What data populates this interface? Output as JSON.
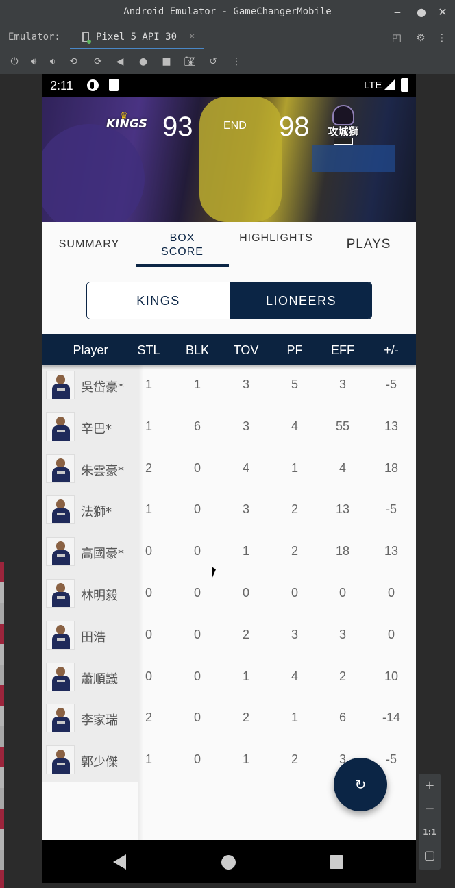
{
  "window": {
    "title": "Android Emulator - GameChangerMobile",
    "minimize_icon": "minimize-icon",
    "close_icon": "close-icon"
  },
  "emulator_bar": {
    "label": "Emulator:",
    "device_tab": "Pixel 5 API 30",
    "tab_close": "×"
  },
  "status": {
    "time": "2:11",
    "network": "LTE"
  },
  "game": {
    "home_team_logo": "KINGS",
    "home_score": "93",
    "period": "END",
    "away_score": "98",
    "away_team_logo": "攻城獅"
  },
  "tabs": [
    {
      "label": "SUMMARY",
      "active": false
    },
    {
      "label": "BOX SCORE",
      "active": true
    },
    {
      "label": "HIGHLIGHTS",
      "active": false
    },
    {
      "label": "PLAYS",
      "active": false
    }
  ],
  "team_toggle": {
    "left": "KINGS",
    "right": "LIONEERS",
    "selected": "LIONEERS"
  },
  "table": {
    "headers": [
      "Player",
      "STL",
      "BLK",
      "TOV",
      "PF",
      "EFF",
      "+/-"
    ],
    "rows": [
      {
        "name": "吳岱豪*",
        "stats": [
          "1",
          "1",
          "3",
          "5",
          "3",
          "-5"
        ]
      },
      {
        "name": "辛巴*",
        "stats": [
          "1",
          "6",
          "3",
          "4",
          "55",
          "13"
        ]
      },
      {
        "name": "朱雲豪*",
        "stats": [
          "2",
          "0",
          "4",
          "1",
          "4",
          "18"
        ]
      },
      {
        "name": "法獅*",
        "stats": [
          "1",
          "0",
          "3",
          "2",
          "13",
          "-5"
        ]
      },
      {
        "name": "高國豪*",
        "stats": [
          "0",
          "0",
          "1",
          "2",
          "18",
          "13"
        ]
      },
      {
        "name": "林明毅",
        "stats": [
          "0",
          "0",
          "0",
          "0",
          "0",
          "0"
        ]
      },
      {
        "name": "田浩",
        "stats": [
          "0",
          "0",
          "2",
          "3",
          "3",
          "0"
        ]
      },
      {
        "name": "蕭順議",
        "stats": [
          "0",
          "0",
          "1",
          "4",
          "2",
          "10"
        ]
      },
      {
        "name": "李家瑞",
        "stats": [
          "2",
          "0",
          "2",
          "1",
          "6",
          "-14"
        ]
      },
      {
        "name": "郭少傑",
        "stats": [
          "1",
          "0",
          "1",
          "2",
          "3",
          "-5"
        ]
      }
    ]
  },
  "fab": {
    "icon": "refresh-icon"
  },
  "zoom": {
    "plus": "+",
    "minus": "−",
    "ratio": "1:1"
  },
  "colors": {
    "navy": "#0b2545",
    "header_navy": "#0c2340"
  }
}
